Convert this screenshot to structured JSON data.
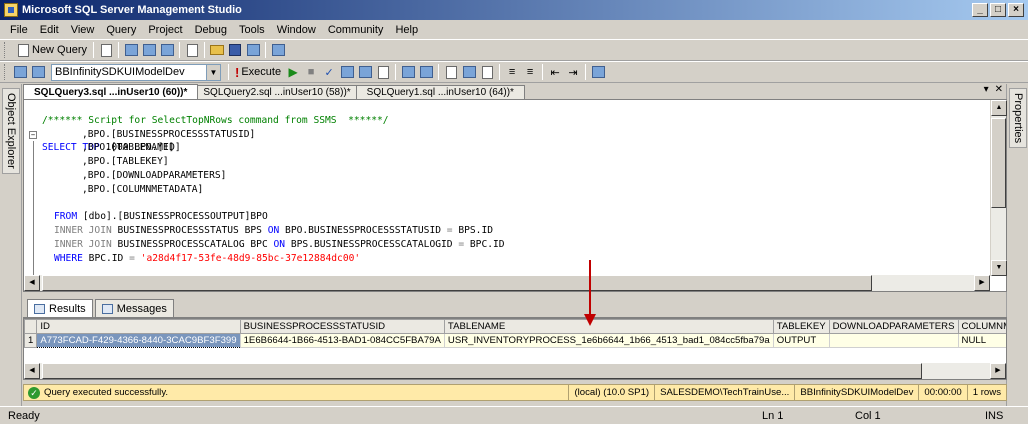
{
  "window": {
    "title": "Microsoft SQL Server Management Studio",
    "buttons": [
      "_",
      "□",
      "×"
    ]
  },
  "menu": [
    "File",
    "Edit",
    "View",
    "Query",
    "Project",
    "Debug",
    "Tools",
    "Window",
    "Community",
    "Help"
  ],
  "toolbar1": {
    "new_query": "New Query"
  },
  "toolbar2": {
    "database": "BBInfinitySDKUIModelDev",
    "execute": "Execute"
  },
  "sidebars": {
    "left": "Object Explorer",
    "right": "Properties"
  },
  "doc_tabs": [
    {
      "label": "SQLQuery3.sql ...inUser10 (60))*",
      "active": true
    },
    {
      "label": "SQLQuery2.sql ...inUser10 (58))*",
      "active": false
    },
    {
      "label": "SQLQuery1.sql ...inUser10 (64))*",
      "active": false
    }
  ],
  "editor": {
    "comment": "/****** Script for SelectTopNRows command from SSMS  ******/",
    "select_kw": "SELECT TOP",
    "select_rest": " 1000 BPO.[ID]",
    "cols": [
      ",BPO.[BUSINESSPROCESSSTATUSID]",
      ",BPO.[TABLENAME]",
      ",BPO.[TABLEKEY]",
      ",BPO.[DOWNLOADPARAMETERS]",
      ",BPO.[COLUMNMETADATA]"
    ],
    "from_kw": "FROM",
    "from_rest": " [dbo].[BUSINESSPROCESSOUTPUT]BPO",
    "join1_kw": "INNER JOIN",
    "join1_table": " BUSINESSPROCESSSTATUS BPS ",
    "on_kw": "ON",
    "join1_cond": " BPO.BUSINESSPROCESSSTATUSID ",
    "eq": "=",
    "join1_rhs": " BPS.ID",
    "join2_kw": "INNER JOIN",
    "join2_table": " BUSINESSPROCESSCATALOG BPC ",
    "join2_cond": " BPS.BUSINESSPROCESSCATALOGID ",
    "join2_rhs": " BPC.ID",
    "where_kw": "WHERE",
    "where_lhs": " BPC.ID ",
    "where_val": "'a28d4f17-53fe-48d9-85bc-37e12884dc00'"
  },
  "results_tabs": [
    "Results",
    "Messages"
  ],
  "grid": {
    "columns": [
      "ID",
      "BUSINESSPROCESSSTATUSID",
      "TABLENAME",
      "TABLEKEY",
      "DOWNLOADPARAMETERS",
      "COLUMNMET"
    ],
    "rows": [
      {
        "num": "1",
        "cells": [
          "A773FCAD-F429-4366-8440-3CAC9BF3F399",
          "1E6B6644-1B66-4513-BAD1-084CC5FBA79A",
          "USR_INVENTORYPROCESS_1e6b6644_1b66_4513_bad1_084cc5fba79a",
          "OUTPUT",
          "",
          "NULL"
        ]
      }
    ]
  },
  "query_status": {
    "message": "Query executed successfully.",
    "server": "(local) (10.0 SP1)",
    "user": "SALESDEMO\\TechTrainUse...",
    "database": "BBInfinitySDKUIModelDev",
    "elapsed": "00:00:00",
    "rows": "1 rows"
  },
  "app_status": {
    "ready": "Ready",
    "ln": "Ln 1",
    "col": "Col 1",
    "ins": "INS"
  },
  "colors": {
    "keyword": "#0000ff",
    "comment": "#008000",
    "string": "#ff0000",
    "status_bg": "#ffeaa8",
    "arrow": "#c00000"
  }
}
